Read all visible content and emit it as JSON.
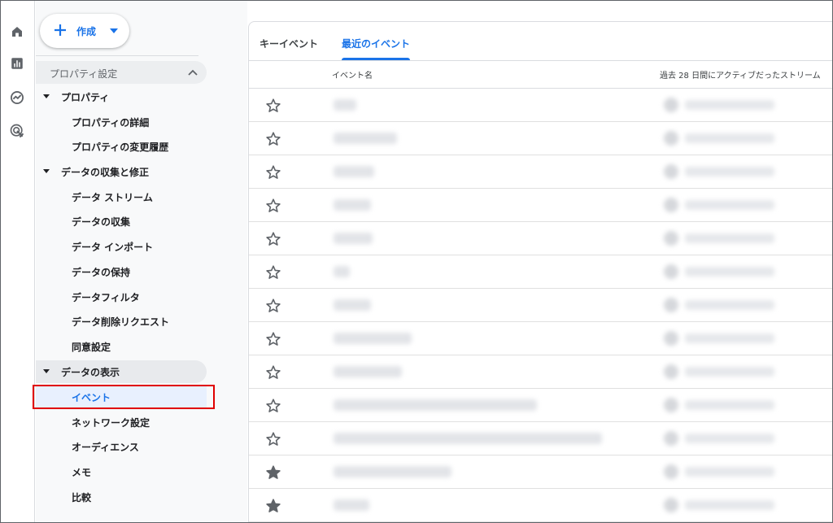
{
  "create_button": {
    "label": "作成"
  },
  "sidebar": {
    "section_title": "プロパティ設定",
    "groups": [
      {
        "label": "プロパティ",
        "items": [
          "プロパティの詳細",
          "プロパティの変更履歴"
        ]
      },
      {
        "label": "データの収集と修正",
        "items": [
          "データ ストリーム",
          "データの収集",
          "データ インポート",
          "データの保持",
          "データフィルタ",
          "データ削除リクエスト",
          "同意設定"
        ]
      },
      {
        "label": "データの表示",
        "items": [
          "イベント",
          "ネットワーク設定",
          "オーディエンス",
          "メモ",
          "比較"
        ]
      }
    ],
    "selected_item": "イベント"
  },
  "tabs": [
    {
      "label": "キーイベント",
      "active": false
    },
    {
      "label": "最近のイベント",
      "active": true
    }
  ],
  "table": {
    "columns": [
      "イベント名",
      "過去 28 日間にアクティブだったストリーム"
    ],
    "rows": [
      {
        "starred": false
      },
      {
        "starred": false
      },
      {
        "starred": false
      },
      {
        "starred": false
      },
      {
        "starred": false
      },
      {
        "starred": false
      },
      {
        "starred": false
      },
      {
        "starred": false
      },
      {
        "starred": false
      },
      {
        "starred": false
      },
      {
        "starred": false
      },
      {
        "starred": true
      },
      {
        "starred": true
      }
    ]
  },
  "colors": {
    "accent": "#1a73e8",
    "highlight": "#e00000",
    "sidebar_bg": "#f8f9fa",
    "selected_bg": "#e8f0fe"
  },
  "icons": [
    "home-icon",
    "reports-icon",
    "explore-icon",
    "advertising-icon",
    "plus-icon",
    "caret-down-icon",
    "chevron-up-icon",
    "star-outline-icon",
    "star-filled-icon"
  ]
}
